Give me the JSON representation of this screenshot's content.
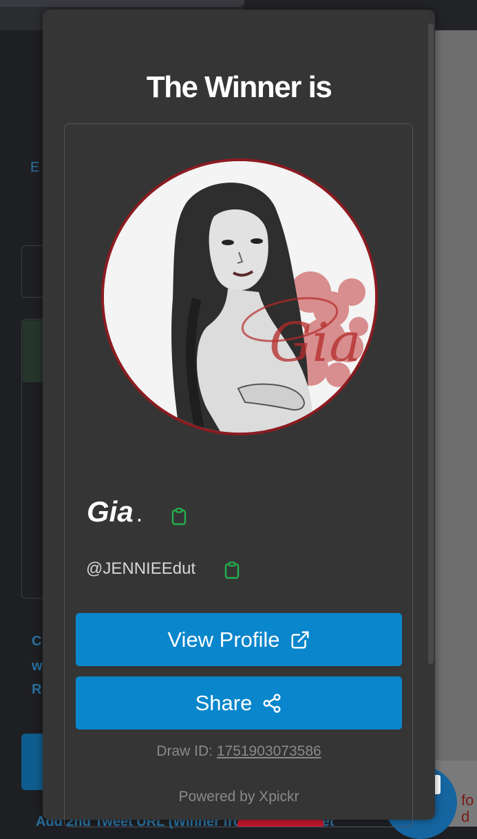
{
  "background": {
    "link_fragment": "E",
    "side_texts": [
      "C",
      "w",
      "R"
    ],
    "bottom_text": "Add 2nd Tweet URL (Winner from either tweet",
    "corner_text": [
      "fo",
      "d"
    ]
  },
  "modal": {
    "title": "The Winner is",
    "winner": {
      "name": "Gia",
      "name_suffix": ".",
      "handle": "@JENNIEEdut",
      "avatar_watermark": "Gia"
    },
    "buttons": {
      "view_profile": {
        "label": "View Profile",
        "icon": "external-link-icon"
      },
      "share": {
        "label": "Share",
        "icon": "share-icon"
      }
    },
    "draw_id_label": "Draw ID:",
    "draw_id_value": "1751903073586",
    "powered_by": "Powered by Xpickr"
  },
  "colors": {
    "modal_bg": "#353535",
    "button_blue": "#0a86cc",
    "copy_icon_green": "#23b14d",
    "avatar_ring": "#8c1b20"
  }
}
